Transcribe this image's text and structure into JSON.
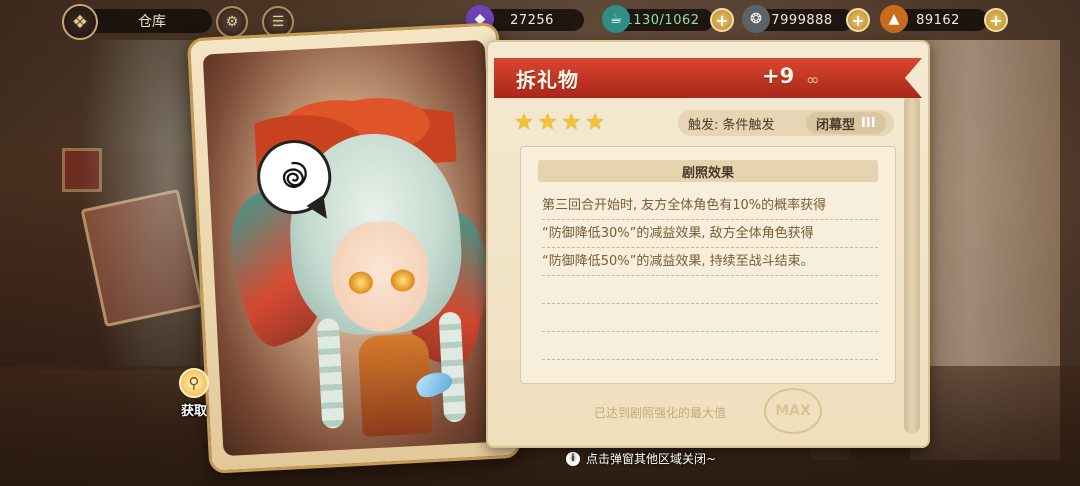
{
  "topbar": {
    "title": "仓库",
    "resources": [
      {
        "name": "crystal",
        "value": "27256",
        "icon": "crystal-icon",
        "color": "#8a5bd6"
      },
      {
        "name": "stamina",
        "value": "1130/1062",
        "icon": "stamina-icon",
        "color": "#4fb9b0"
      },
      {
        "name": "coin",
        "value": "7999888",
        "icon": "coin-icon",
        "color": "#9aa3a8"
      },
      {
        "name": "carrot",
        "value": "89162",
        "icon": "carrot-icon",
        "color": "#f08a2a"
      }
    ],
    "plus_label": "+"
  },
  "card": {
    "bubble_icon": "scribble-icon"
  },
  "acquire": {
    "label": "获取"
  },
  "detail": {
    "name": "拆礼物",
    "level": "+9",
    "stars": 4,
    "trigger_label": "触发: 条件触发",
    "type_label": "闭幕型",
    "type_rank": "III",
    "effect_title": "剧照效果",
    "effect_lines": [
      "第三回合开始时, 友方全体角色有10%的概率获得",
      "“防御降低30%”的减益效果, 敌方全体角色获得",
      "“防御降低50%”的减益效果, 持续至战斗结束。",
      "",
      "",
      ""
    ],
    "max_note": "已达到剧照强化的最大值",
    "max_label": "MAX"
  },
  "close_hint": "点击弹窗其他区域关闭~",
  "colors": {
    "ribbon": "#c5341f",
    "star": "#f3c52b",
    "panel": "#f4ead2"
  }
}
